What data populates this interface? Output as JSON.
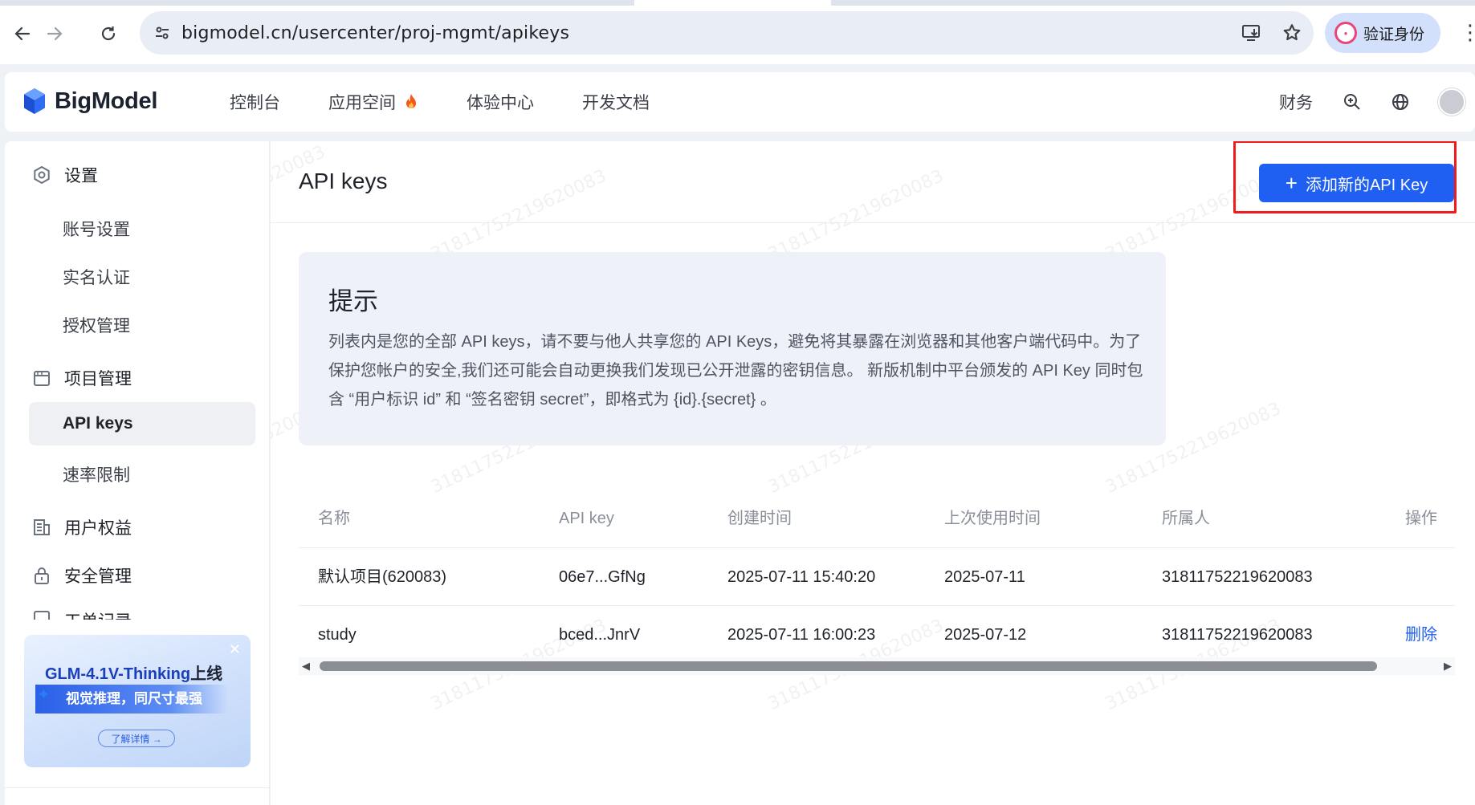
{
  "browser": {
    "url": "bigmodel.cn/usercenter/proj-mgmt/apikeys",
    "profile_label": "验证身份",
    "icons": [
      "back-icon",
      "forward-icon",
      "reload-icon",
      "site-info-icon",
      "install-app-icon",
      "bookmark-star-icon",
      "more-menu-icon"
    ]
  },
  "header": {
    "brand": "BigModel",
    "nav": [
      "控制台",
      "应用空间",
      "体验中心",
      "开发文档"
    ],
    "finance": "财务"
  },
  "sidebar": {
    "groups": [
      {
        "label": "设置",
        "icon": "settings-icon",
        "items": [
          "账号设置",
          "实名认证",
          "授权管理"
        ]
      },
      {
        "label": "项目管理",
        "icon": "project-icon",
        "items": [
          "API keys",
          "速率限制"
        ]
      },
      {
        "label": "用户权益",
        "icon": "benefits-icon",
        "items": []
      },
      {
        "label": "安全管理",
        "icon": "lock-icon",
        "items": []
      },
      {
        "label": "工单记录",
        "icon": "ticket-icon",
        "items": []
      }
    ],
    "active": "API keys",
    "promo": {
      "title_highlight": "GLM-4.1V-Thinking",
      "title_tail": "上线",
      "subtitle": "视觉推理，同尺寸最强",
      "cta": "了解详情 →"
    }
  },
  "main": {
    "title": "API keys",
    "add_button": "添加新的API Key",
    "tip": {
      "heading": "提示",
      "body": "列表内是您的全部 API keys，请不要与他人共享您的 API Keys，避免将其暴露在浏览器和其他客户端代码中。为了保护您帐户的安全,我们还可能会自动更换我们发现已公开泄露的密钥信息。 新版机制中平台颁发的 API Key 同时包含 “用户标识 id” 和 “签名密钥 secret”，即格式为 {id}.{secret} 。"
    },
    "table": {
      "columns": [
        "名称",
        "API key",
        "创建时间",
        "上次使用时间",
        "所属人",
        "操作"
      ],
      "rows": [
        {
          "name": "默认项目(620083)",
          "key": "06e7...GfNg",
          "created": "2025-07-11 15:40:20",
          "last_used": "2025-07-11",
          "owner": "31811752219620083",
          "action": ""
        },
        {
          "name": "study",
          "key": "bced...JnrV",
          "created": "2025-07-11 16:00:23",
          "last_used": "2025-07-12",
          "owner": "31811752219620083",
          "action": "删除"
        }
      ]
    },
    "watermark": "31811752219620083"
  },
  "colors": {
    "accent": "#1f5ff2",
    "highlight_box": "#ee1c1c"
  }
}
